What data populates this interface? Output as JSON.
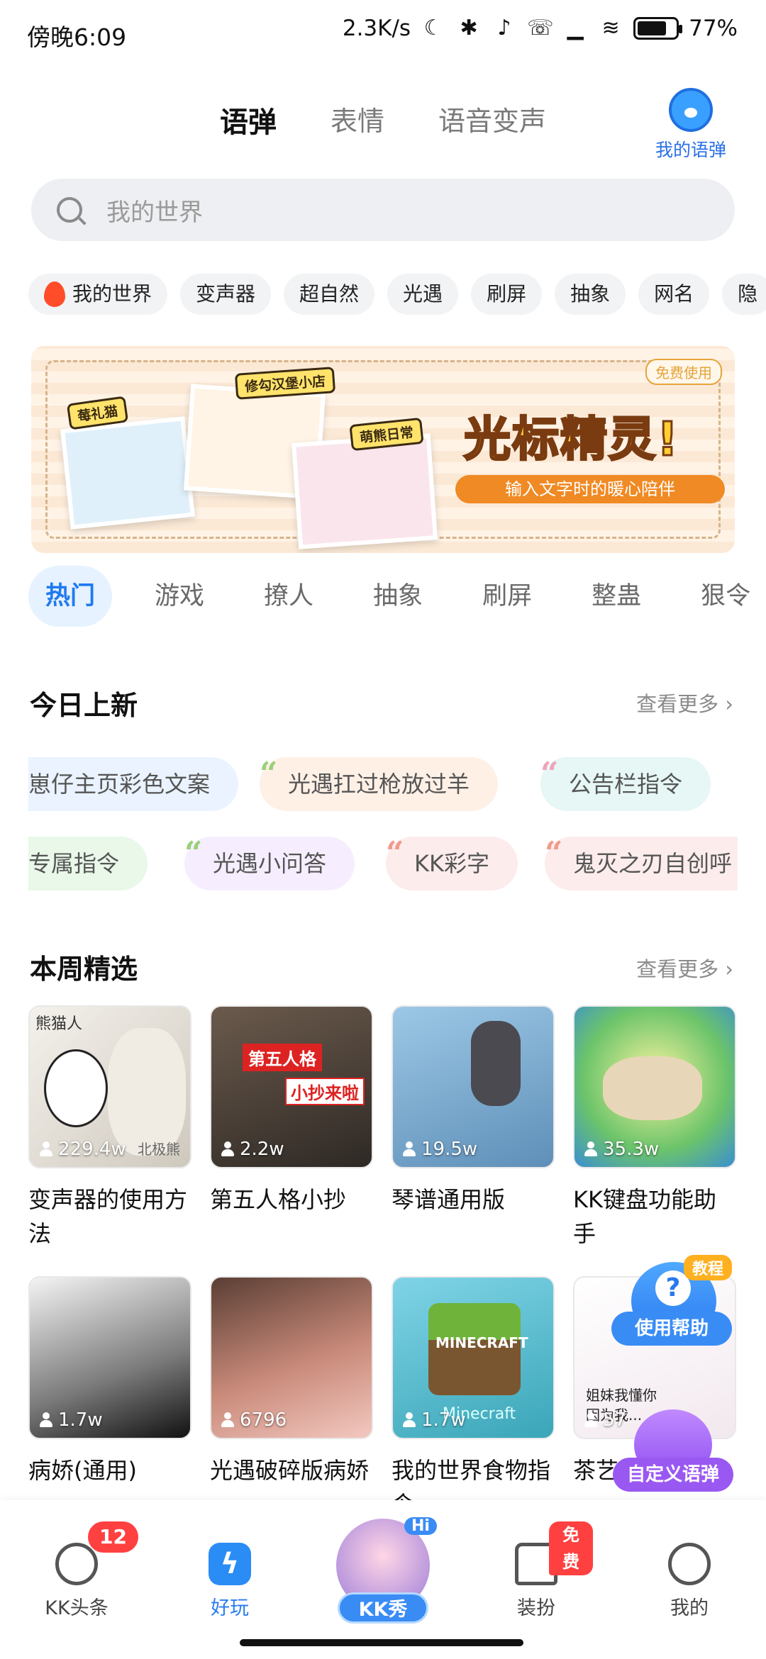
{
  "status_bar": {
    "time": "傍晚6:09",
    "net_speed": "2.3K/s",
    "battery": "77%",
    "battery_level": 0.77
  },
  "top_tabs": [
    {
      "label": "语弹",
      "active": true
    },
    {
      "label": "表情",
      "active": false
    },
    {
      "label": "语音变声",
      "active": false
    }
  ],
  "my_yudan_label": "我的语弹",
  "search": {
    "placeholder": "我的世界"
  },
  "chips": [
    "我的世界",
    "变声器",
    "超自然",
    "光遇",
    "刷屏",
    "抽象",
    "网名",
    "隐"
  ],
  "banner": {
    "title": "光标精灵!",
    "subtitle": "输入文字时的暖心陪伴",
    "badge": "免费使用",
    "tags": [
      "莓礼猫",
      "修勾汉堡小店",
      "萌熊日常"
    ]
  },
  "category_tabs": [
    {
      "label": "热门",
      "active": true
    },
    {
      "label": "游戏"
    },
    {
      "label": "撩人"
    },
    {
      "label": "抽象"
    },
    {
      "label": "刷屏"
    },
    {
      "label": "整蛊"
    },
    {
      "label": "狠令"
    }
  ],
  "today_new": {
    "title": "今日上新",
    "more": "查看更多 ›",
    "row1": [
      "崽仔主页彩色文案",
      "光遇扛过枪放过羊",
      "公告栏指令"
    ],
    "row2": [
      "专属指令",
      "光遇小问答",
      "KK彩字",
      "鬼灭之刃自创呼"
    ]
  },
  "weekly": {
    "title": "本周精选",
    "more": "查看更多 ›",
    "cards": [
      {
        "title": "变声器的使用方法",
        "views": "229.4w",
        "overlay": [
          "熊猫人",
          "北极熊"
        ]
      },
      {
        "title": "第五人格小抄",
        "views": "2.2w",
        "overlay": [
          "第五人格",
          "小抄来啦"
        ]
      },
      {
        "title": "琴谱通用版",
        "views": "19.5w",
        "overlay": []
      },
      {
        "title": "KK键盘功能助手",
        "views": "35.3w",
        "overlay": []
      },
      {
        "title": "病娇(通用)",
        "views": "1.7w",
        "overlay": []
      },
      {
        "title": "光遇破碎版病娇",
        "views": "6796",
        "overlay": []
      },
      {
        "title": "我的世界食物指令",
        "views": "1.7w",
        "overlay": [
          "MINECRAFT",
          "Minecraft"
        ]
      },
      {
        "title": "茶艺笔记",
        "views": "57",
        "overlay": [
          "姐妹我懂你",
          "因为我..."
        ]
      }
    ]
  },
  "float_help": {
    "badge": "教程",
    "label": "使用帮助"
  },
  "float_custom": {
    "label": "自定义语弹"
  },
  "bottom_nav": [
    {
      "label": "KK头条",
      "badge": "12"
    },
    {
      "label": "好玩",
      "active": true
    },
    {
      "label": "KK秀",
      "badge": "Hi"
    },
    {
      "label": "装扮",
      "badge": "免费"
    },
    {
      "label": "我的"
    }
  ]
}
